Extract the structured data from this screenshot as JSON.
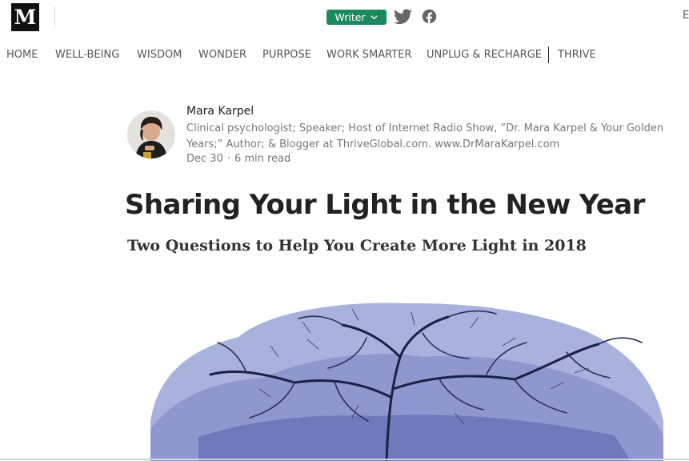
{
  "header": {
    "logo": "M",
    "writer_button": "Writer",
    "truncated_right": "E",
    "icons": [
      "twitter-icon",
      "facebook-icon",
      "chevron-down-icon"
    ]
  },
  "nav": {
    "items": [
      {
        "label": "HOME"
      },
      {
        "label": "WELL-BEING"
      },
      {
        "label": "WISDOM"
      },
      {
        "label": "WONDER"
      },
      {
        "label": "PURPOSE"
      },
      {
        "label": "WORK SMARTER"
      },
      {
        "label": "UNPLUG & RECHARGE"
      },
      {
        "label": "THRIVE"
      }
    ]
  },
  "author": {
    "name": "Mara Karpel",
    "bio": "Clinical psychologist; Speaker; Host of Internet Radio Show, ”Dr. Mara Karpel & Your Golden Years;” Author; & Blogger at ThriveGlobal.com. www.DrMaraKarpel.com",
    "date": "Dec 30",
    "read_time": "6 min read",
    "separator": "·"
  },
  "article": {
    "title": "Sharing Your Light in the New Year",
    "subtitle": "Two Questions to Help You Create More Light in 2018"
  },
  "colors": {
    "brand_green": "#1a8a5a",
    "logo_black": "#111111",
    "text_primary": "#222222",
    "text_muted": "#777777",
    "hero_blue": "#7a84c4"
  }
}
